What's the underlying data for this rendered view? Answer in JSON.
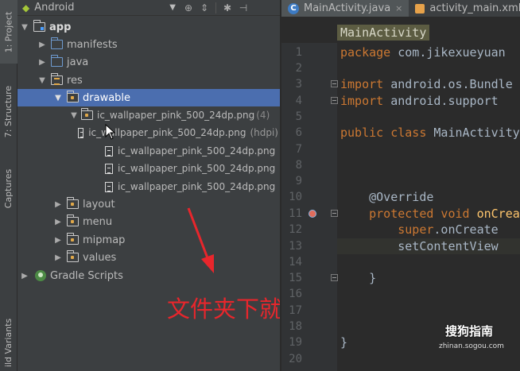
{
  "toolstrip": {
    "tabs": [
      {
        "label": "1: Project"
      },
      {
        "label": "7: Structure"
      },
      {
        "label": "Captures"
      },
      {
        "label": "ild Variants"
      }
    ]
  },
  "project_panel": {
    "view_selector": "Android",
    "tree": [
      {
        "label": "app"
      },
      {
        "label": "manifests"
      },
      {
        "label": "java"
      },
      {
        "label": "res"
      },
      {
        "label": "drawable"
      },
      {
        "label": "ic_wallpaper_pink_500_24dp.png",
        "suffix": "(4)"
      },
      {
        "label": "ic_wallpaper_pink_500_24dp.png",
        "suffix": "(hdpi)"
      },
      {
        "label": "ic_wallpaper_pink_500_24dp.png"
      },
      {
        "label": "ic_wallpaper_pink_500_24dp.png"
      },
      {
        "label": "ic_wallpaper_pink_500_24dp.png"
      },
      {
        "label": "layout"
      },
      {
        "label": "menu"
      },
      {
        "label": "mipmap"
      },
      {
        "label": "values"
      },
      {
        "label": "Gradle Scripts"
      }
    ]
  },
  "annotation": {
    "text": "文件夹下就会产生图标",
    "color": "#e8262c"
  },
  "editor": {
    "tabs": [
      {
        "label": "MainActivity.java"
      },
      {
        "label": "activity_main.xml"
      }
    ],
    "class_breadcrumb": "MainActivity",
    "lines": [
      {
        "num": "1",
        "code": "package com.jikexueyuan"
      },
      {
        "num": "2",
        "code": ""
      },
      {
        "num": "3",
        "code": "import android.os.Bundle"
      },
      {
        "num": "4",
        "code": "import android.support"
      },
      {
        "num": "5",
        "code": ""
      },
      {
        "num": "6",
        "code": "public class MainActivity"
      },
      {
        "num": "7",
        "code": ""
      },
      {
        "num": "8",
        "code": ""
      },
      {
        "num": "9",
        "code": ""
      },
      {
        "num": "10",
        "code": "    @Override"
      },
      {
        "num": "11",
        "code": "    protected void onCreate"
      },
      {
        "num": "12",
        "code": "        super.onCreate"
      },
      {
        "num": "13",
        "code": "        setContentView"
      },
      {
        "num": "14",
        "code": ""
      },
      {
        "num": "15",
        "code": "    }"
      },
      {
        "num": "16",
        "code": ""
      },
      {
        "num": "17",
        "code": ""
      },
      {
        "num": "18",
        "code": ""
      },
      {
        "num": "19",
        "code": "}"
      },
      {
        "num": "20",
        "code": ""
      }
    ]
  },
  "watermark": {
    "brand": "搜狗指南",
    "url": "zhinan.sogou.com"
  }
}
